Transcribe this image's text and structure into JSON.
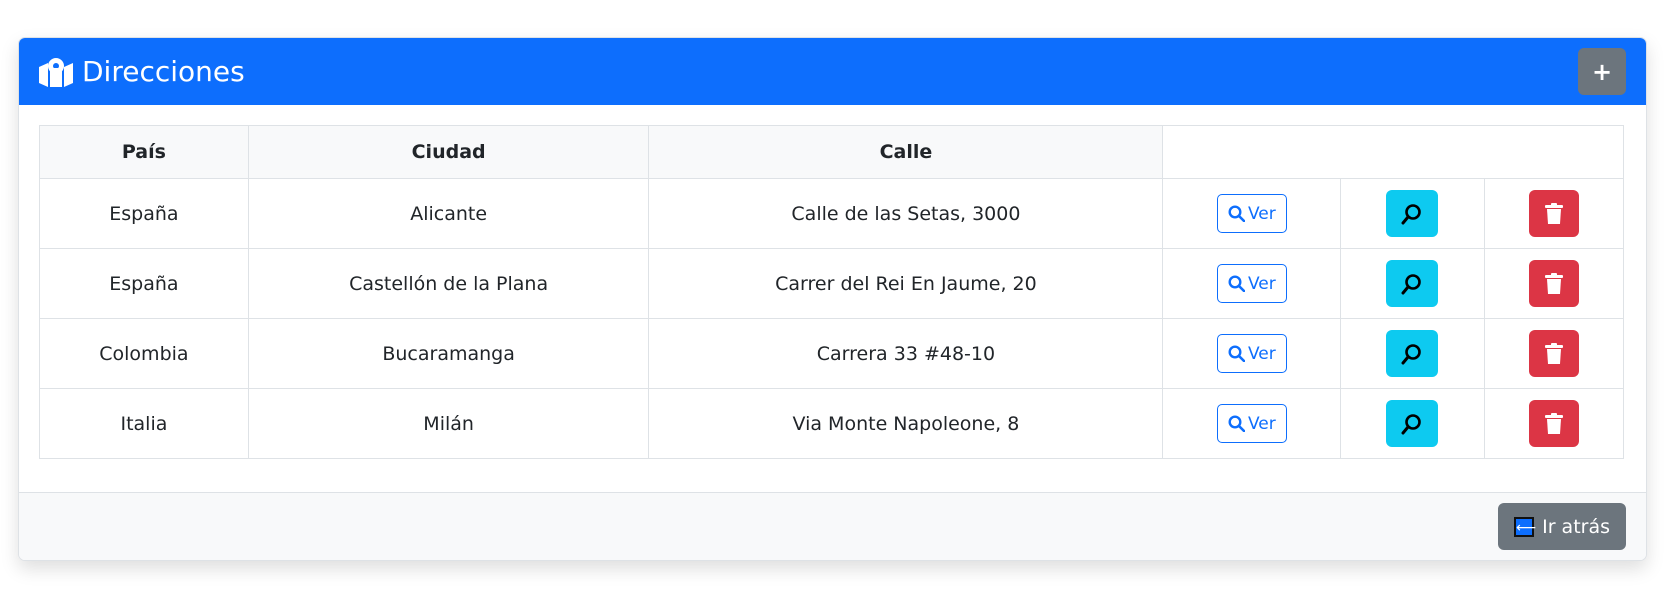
{
  "header": {
    "title": "Direcciones",
    "add_label": "+"
  },
  "table": {
    "headers": [
      "País",
      "Ciudad",
      "Calle"
    ],
    "rows": [
      {
        "pais": "España",
        "ciudad": "Alicante",
        "calle": "Calle de las Setas, 3000",
        "ver": "Ver"
      },
      {
        "pais": "España",
        "ciudad": "Castellón de la Plana",
        "calle": "Carrer del Rei En Jaume, 20",
        "ver": "Ver"
      },
      {
        "pais": "Colombia",
        "ciudad": "Bucaramanga",
        "calle": "Carrera 33 #48-10",
        "ver": "Ver"
      },
      {
        "pais": "Italia",
        "ciudad": "Milán",
        "calle": "Via Monte Napoleone, 8",
        "ver": "Ver"
      }
    ]
  },
  "footer": {
    "back_label": "Ir atrás",
    "back_icon_glyph": "⟵"
  },
  "icons": {
    "header_icon": "map-location-icon",
    "ver_icon": "search-icon",
    "search_icon": "magnifying-glass-icon",
    "delete_icon": "trash-icon",
    "back_icon": "arrow-left-icon"
  },
  "colors": {
    "primary": "#0d6efd",
    "secondary": "#6c757d",
    "info": "#0dcaf0",
    "danger": "#dc3545"
  }
}
